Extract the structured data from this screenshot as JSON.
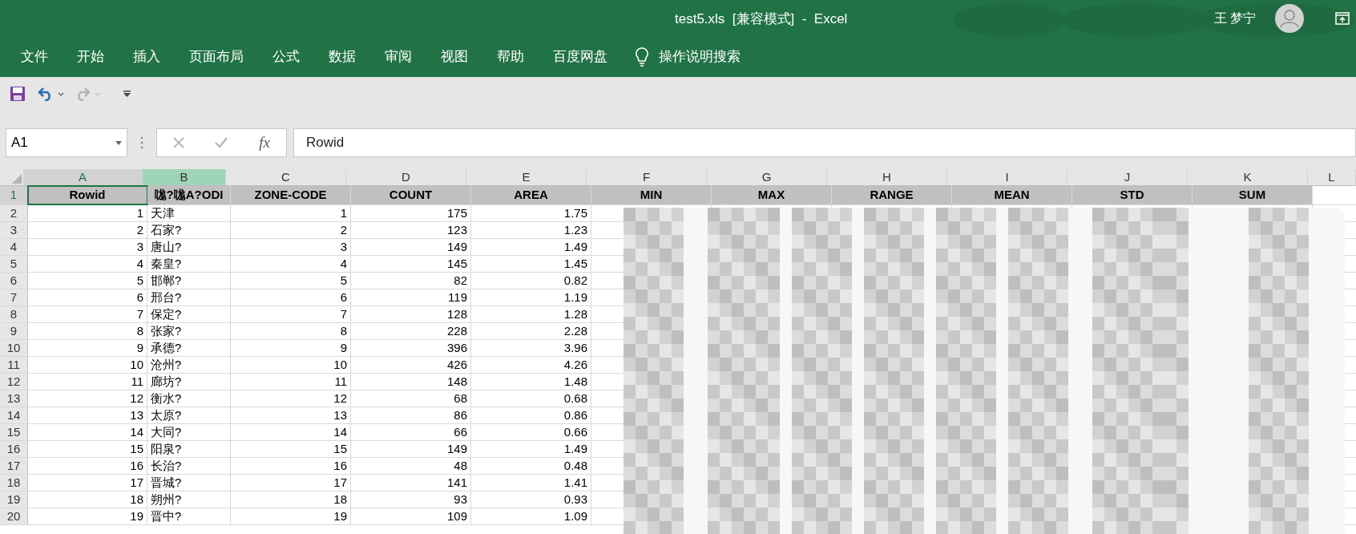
{
  "window": {
    "title": "test5.xls  [兼容模式]  -  Excel",
    "user": "王 梦宁"
  },
  "ribbon_tabs": [
    {
      "label": "文件",
      "selected": false
    },
    {
      "label": "开始",
      "selected": false
    },
    {
      "label": "插入",
      "selected": false
    },
    {
      "label": "页面布局",
      "selected": false
    },
    {
      "label": "公式",
      "selected": false
    },
    {
      "label": "数据",
      "selected": false
    },
    {
      "label": "审阅",
      "selected": false
    },
    {
      "label": "视图",
      "selected": false
    },
    {
      "label": "帮助",
      "selected": false
    },
    {
      "label": "百度网盘",
      "selected": false
    }
  ],
  "tell_me": {
    "placeholder": "操作说明搜索"
  },
  "quick_access": [
    {
      "kind": "save",
      "disabled": false
    },
    {
      "kind": "undo",
      "disabled": false
    },
    {
      "kind": "redo",
      "disabled": true
    },
    {
      "kind": "customize",
      "disabled": false
    }
  ],
  "formula_bar": {
    "name_box": "A1",
    "fx": "fx",
    "value": "Rowid",
    "cancel_disabled": true,
    "enter_disabled": true
  },
  "sheet": {
    "columns": [
      {
        "label": "A",
        "selected": true,
        "highlighted": false
      },
      {
        "label": "B",
        "selected": false,
        "highlighted": true
      },
      {
        "label": "C",
        "selected": false,
        "highlighted": false
      },
      {
        "label": "D",
        "selected": false,
        "highlighted": false
      },
      {
        "label": "E",
        "selected": false,
        "highlighted": false
      },
      {
        "label": "F",
        "selected": false,
        "highlighted": false
      },
      {
        "label": "G",
        "selected": false,
        "highlighted": false
      },
      {
        "label": "H",
        "selected": false,
        "highlighted": false
      },
      {
        "label": "I",
        "selected": false,
        "highlighted": false
      },
      {
        "label": "J",
        "selected": false,
        "highlighted": false
      },
      {
        "label": "K",
        "selected": false,
        "highlighted": false
      },
      {
        "label": "L",
        "selected": false,
        "highlighted": false
      }
    ],
    "rows": [
      {
        "label": "1",
        "selected": true,
        "cells": [
          "Rowid",
          "哤?哤A?ODI",
          "ZONE-CODE",
          "COUNT",
          "AREA",
          "MIN",
          "MAX",
          "RANGE",
          "MEAN",
          "STD",
          "SUM"
        ]
      },
      {
        "label": "2",
        "selected": false,
        "cells": [
          "1",
          "天津",
          "1",
          "175",
          "1.75"
        ]
      },
      {
        "label": "3",
        "selected": false,
        "cells": [
          "2",
          "石家?",
          "2",
          "123",
          "1.23"
        ]
      },
      {
        "label": "4",
        "selected": false,
        "cells": [
          "3",
          "唐山?",
          "3",
          "149",
          "1.49"
        ]
      },
      {
        "label": "5",
        "selected": false,
        "cells": [
          "4",
          "秦皇?",
          "4",
          "145",
          "1.45"
        ]
      },
      {
        "label": "6",
        "selected": false,
        "cells": [
          "5",
          "邯郸?",
          "5",
          "82",
          "0.82"
        ]
      },
      {
        "label": "7",
        "selected": false,
        "cells": [
          "6",
          "邢台?",
          "6",
          "119",
          "1.19"
        ]
      },
      {
        "label": "8",
        "selected": false,
        "cells": [
          "7",
          "保定?",
          "7",
          "128",
          "1.28"
        ]
      },
      {
        "label": "9",
        "selected": false,
        "cells": [
          "8",
          "张家?",
          "8",
          "228",
          "2.28"
        ]
      },
      {
        "label": "10",
        "selected": false,
        "cells": [
          "9",
          "承德?",
          "9",
          "396",
          "3.96"
        ]
      },
      {
        "label": "11",
        "selected": false,
        "cells": [
          "10",
          "沧州?",
          "10",
          "426",
          "4.26"
        ]
      },
      {
        "label": "12",
        "selected": false,
        "cells": [
          "11",
          "廊坊?",
          "11",
          "148",
          "1.48"
        ]
      },
      {
        "label": "13",
        "selected": false,
        "cells": [
          "12",
          "衡水?",
          "12",
          "68",
          "0.68"
        ]
      },
      {
        "label": "14",
        "selected": false,
        "cells": [
          "13",
          "太原?",
          "13",
          "86",
          "0.86"
        ]
      },
      {
        "label": "15",
        "selected": false,
        "cells": [
          "14",
          "大同?",
          "14",
          "66",
          "0.66"
        ]
      },
      {
        "label": "16",
        "selected": false,
        "cells": [
          "15",
          "阳泉?",
          "15",
          "149",
          "1.49"
        ]
      },
      {
        "label": "17",
        "selected": false,
        "cells": [
          "16",
          "长治?",
          "16",
          "48",
          "0.48"
        ]
      },
      {
        "label": "18",
        "selected": false,
        "cells": [
          "17",
          "晋城?",
          "17",
          "141",
          "1.41"
        ]
      },
      {
        "label": "19",
        "selected": false,
        "cells": [
          "18",
          "朔州?",
          "18",
          "93",
          "0.93"
        ]
      },
      {
        "label": "20",
        "selected": false,
        "cells": [
          "19",
          "晋中?",
          "19",
          "109",
          "1.09"
        ]
      }
    ]
  }
}
